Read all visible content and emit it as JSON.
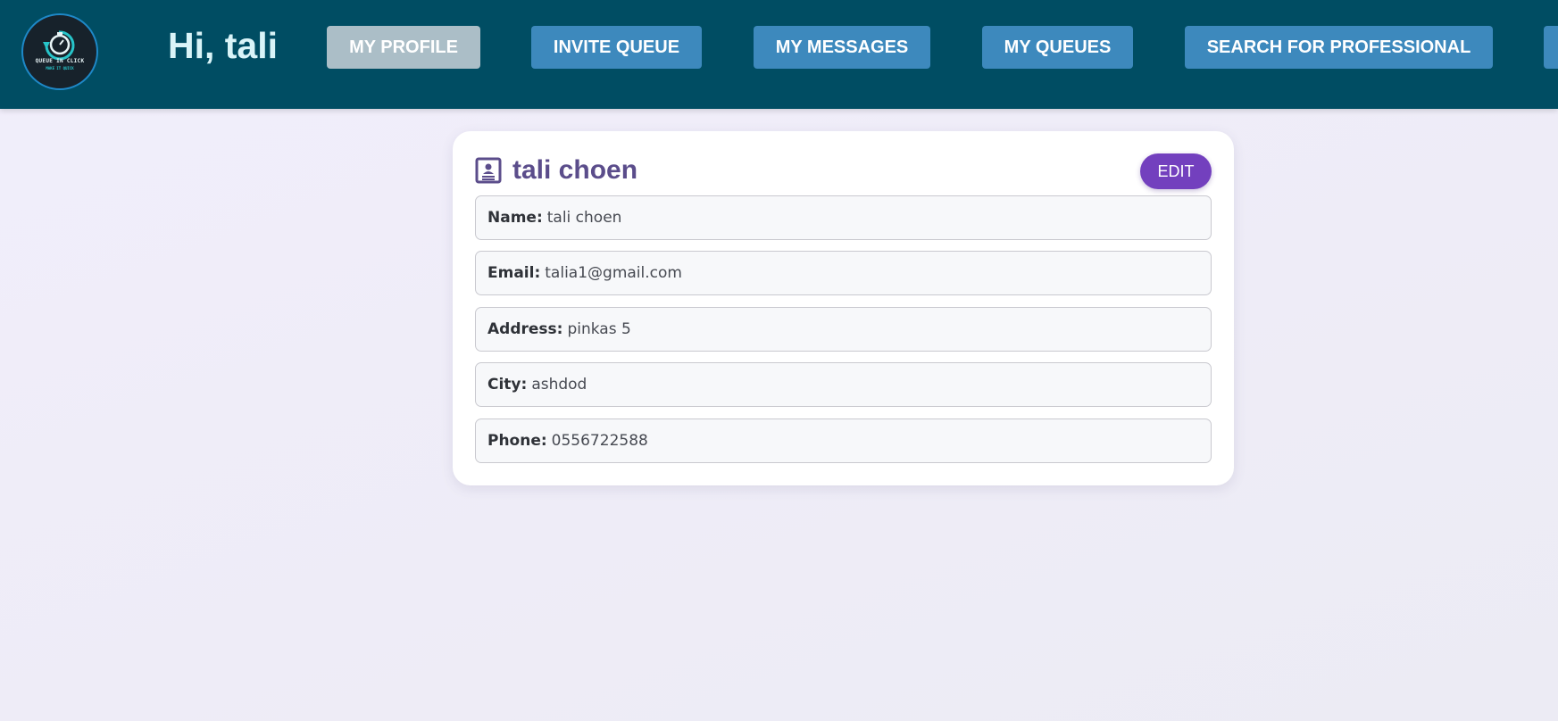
{
  "header": {
    "logo": {
      "line1": "QUEUE IN CLICK",
      "line2": "MAKE IT QUICK",
      "icon": "stopwatch-icon"
    },
    "greeting": "Hi, tali",
    "nav": [
      {
        "label": "MY PROFILE",
        "active": true
      },
      {
        "label": "INVITE QUEUE",
        "active": false
      },
      {
        "label": "MY MESSAGES",
        "active": false
      },
      {
        "label": "MY QUEUES",
        "active": false
      },
      {
        "label": "SEARCH FOR PROFESSIONAL",
        "active": false
      }
    ]
  },
  "profile": {
    "icon": "contact-card-icon",
    "title": "tali choen",
    "edit_label": "EDIT",
    "fields": [
      {
        "label": "Name:",
        "value": "tali choen"
      },
      {
        "label": "Email:",
        "value": "talia1@gmail.com"
      },
      {
        "label": "Address:",
        "value": "pinkas 5"
      },
      {
        "label": "City:",
        "value": "ashdod"
      },
      {
        "label": "Phone:",
        "value": "0556722588"
      }
    ]
  },
  "colors": {
    "header_bg": "#004d63",
    "nav_button": "#3d89bd",
    "nav_button_active": "#abbec7",
    "edit_button": "#7340be",
    "title_text": "#5b4d8b"
  }
}
